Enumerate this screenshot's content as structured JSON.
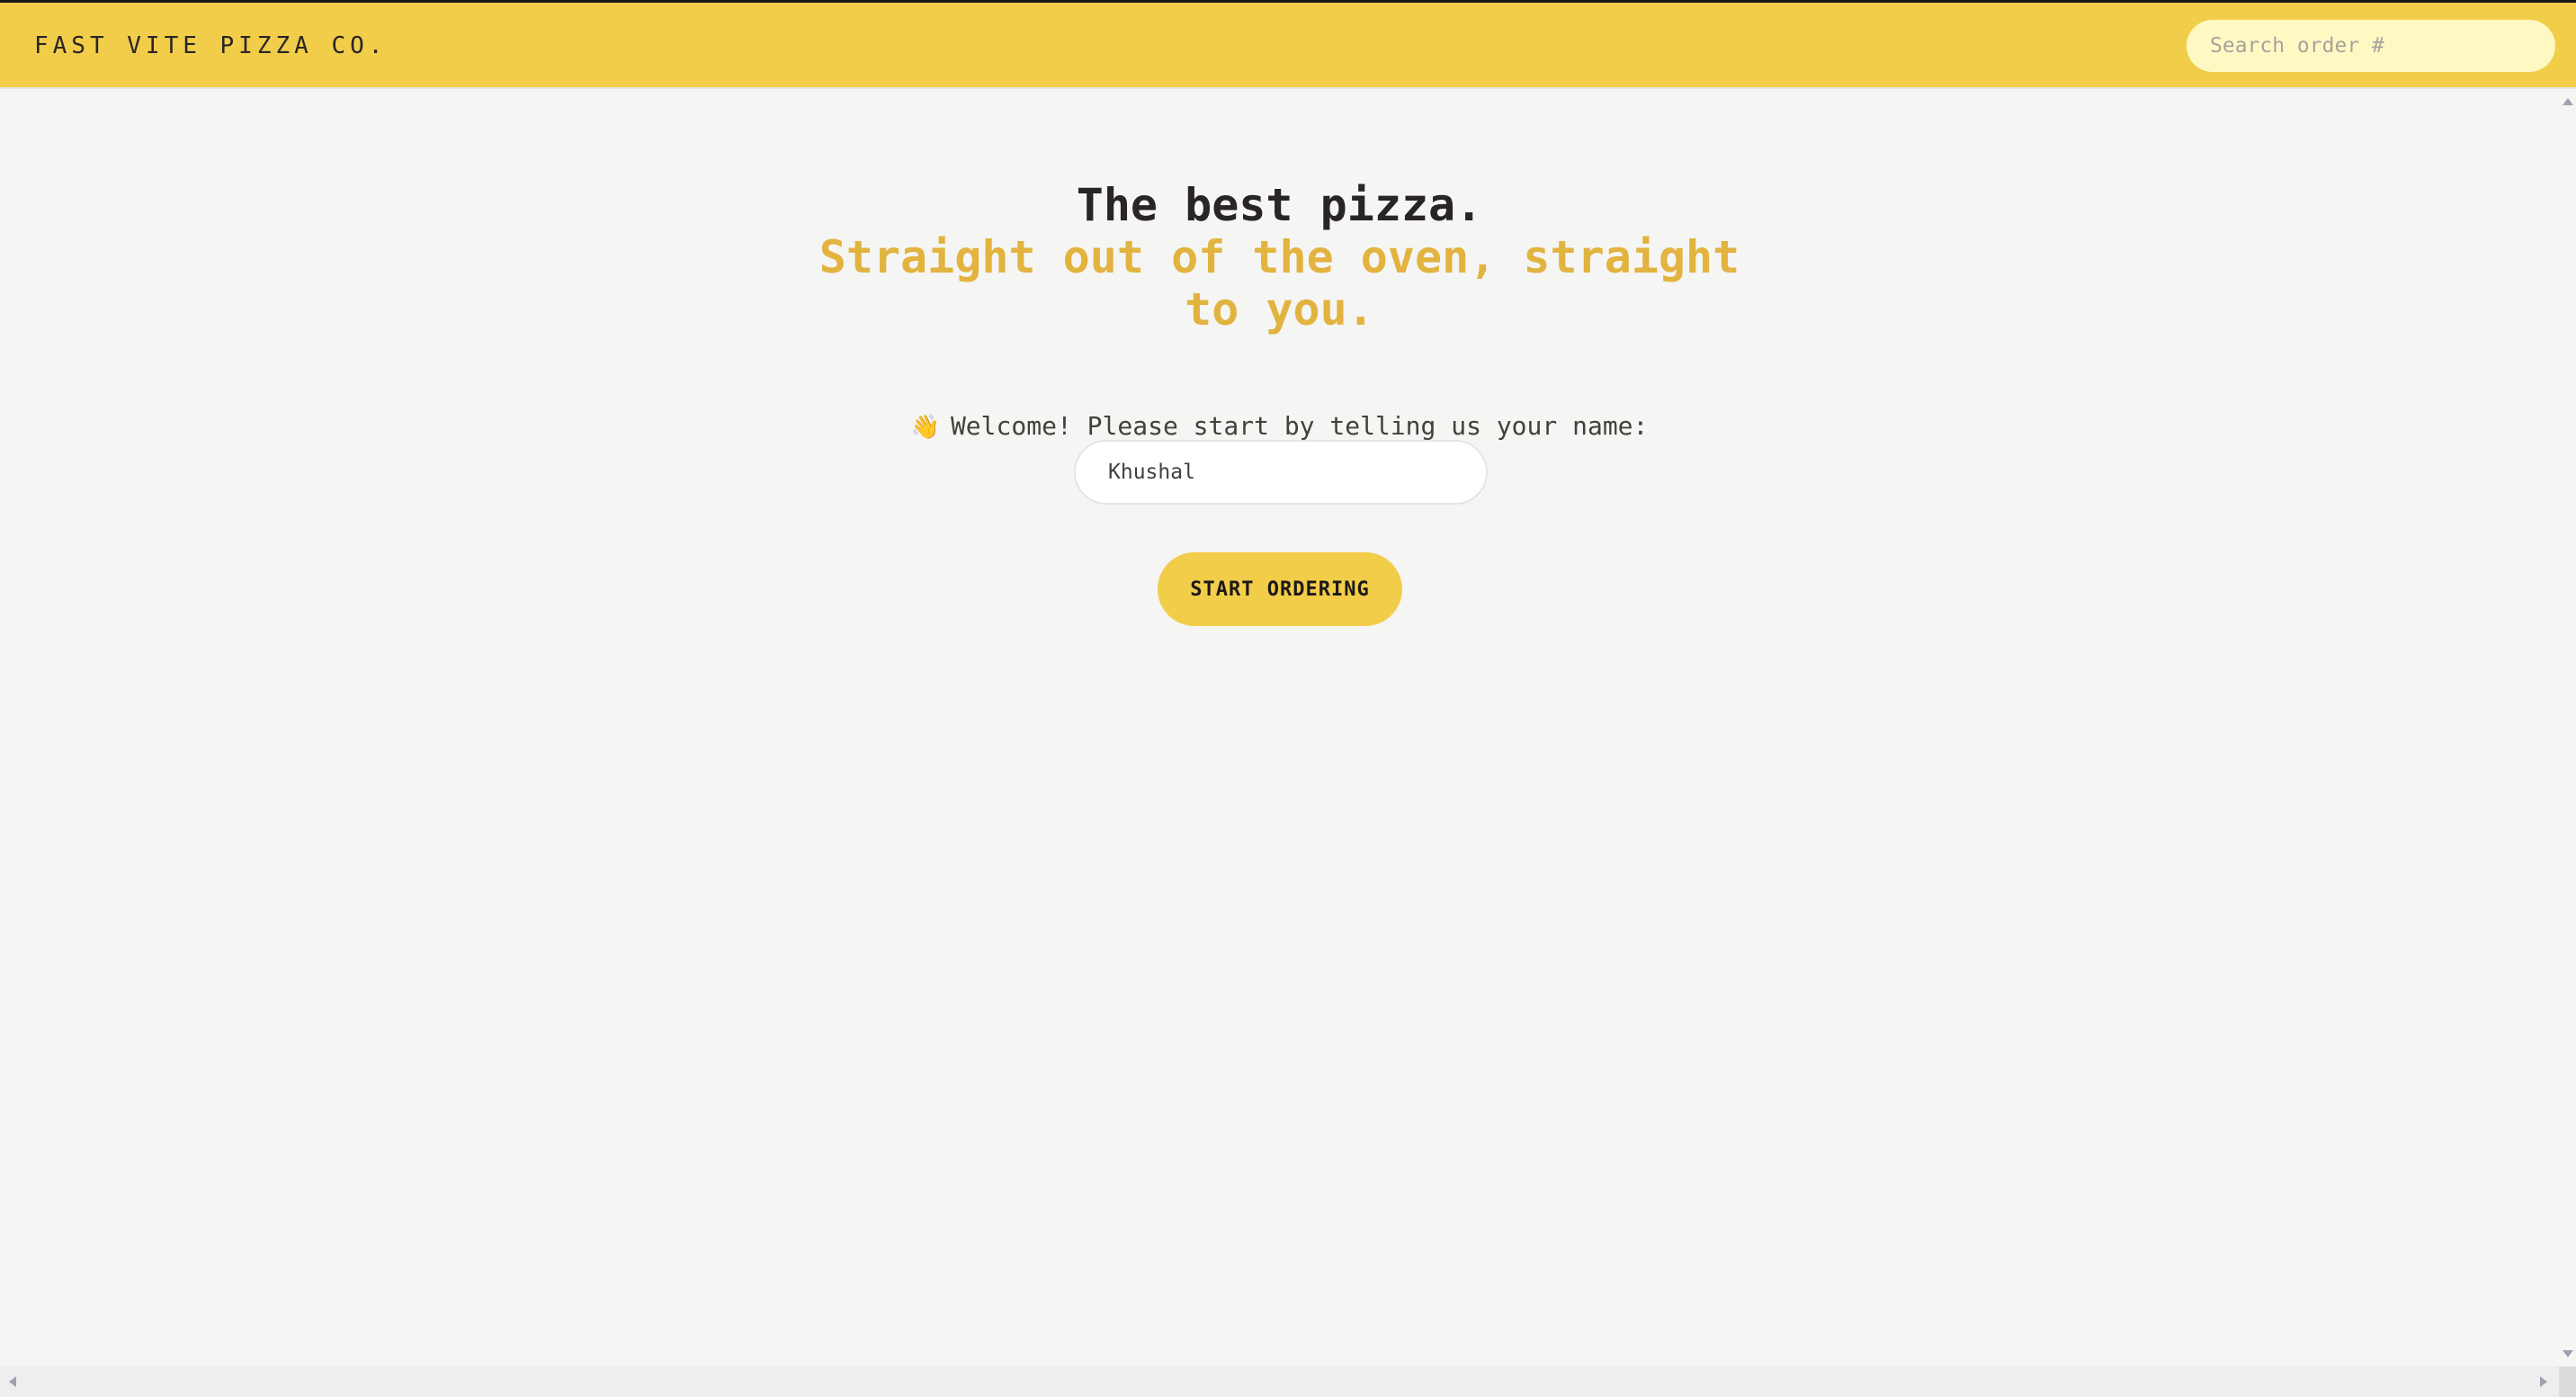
{
  "header": {
    "brand": "FAST VITE PIZZA CO.",
    "search_placeholder": "Search order #"
  },
  "main": {
    "title_line1": "The best pizza.",
    "title_line2": "Straight out of the oven, straight to you.",
    "wave_icon": "👋",
    "welcome_text": "Welcome! Please start by telling us your name:",
    "name_value": "Khushal",
    "start_button": "START ORDERING"
  },
  "colors": {
    "header_bg": "#f2cd4a",
    "accent": "#e2b33f",
    "search_bg": "#fef9c3",
    "page_bg": "#f5f5f4"
  }
}
